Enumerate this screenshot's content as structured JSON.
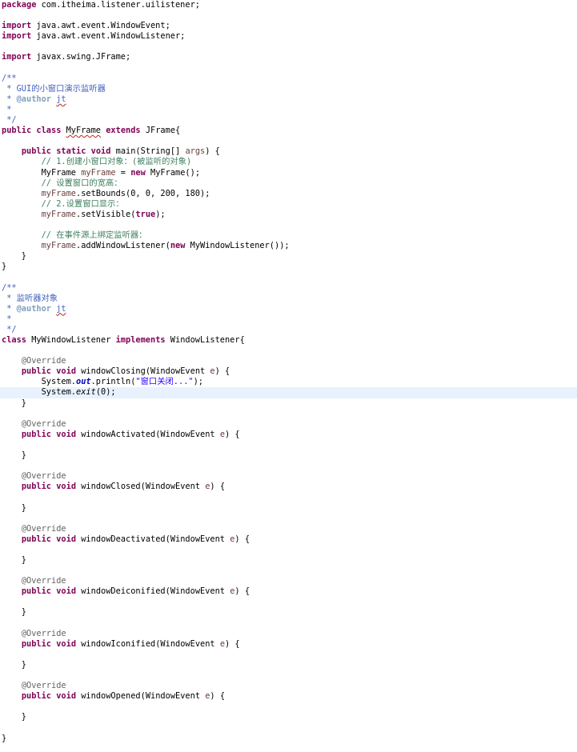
{
  "editor": {
    "lines": [
      [
        {
          "t": "package",
          "c": "kw"
        },
        {
          "t": " com.itheima.listener.uilistener;"
        }
      ],
      [],
      [
        {
          "t": "import",
          "c": "kw"
        },
        {
          "t": " java.awt.event.WindowEvent;"
        }
      ],
      [
        {
          "t": "import",
          "c": "kw"
        },
        {
          "t": " java.awt.event.WindowListener;"
        }
      ],
      [],
      [
        {
          "t": "import",
          "c": "kw"
        },
        {
          "t": " javax.swing.JFrame;"
        }
      ],
      [],
      [
        {
          "t": "/**",
          "c": "jd"
        }
      ],
      [
        {
          "t": " * GUI的小窗口演示监听器",
          "c": "jd"
        }
      ],
      [
        {
          "t": " * ",
          "c": "jd"
        },
        {
          "t": "@author",
          "c": "tag"
        },
        {
          "t": " ",
          "c": "jd"
        },
        {
          "t": "jt",
          "c": "jd sq"
        }
      ],
      [
        {
          "t": " *",
          "c": "jd"
        }
      ],
      [
        {
          "t": " */",
          "c": "jd"
        }
      ],
      [
        {
          "t": "public",
          "c": "kw"
        },
        {
          "t": " "
        },
        {
          "t": "class",
          "c": "kw"
        },
        {
          "t": " "
        },
        {
          "t": "MyFrame",
          "c": "sq"
        },
        {
          "t": " "
        },
        {
          "t": "extends",
          "c": "kw"
        },
        {
          "t": " JFrame{"
        }
      ],
      [],
      [
        {
          "t": "    "
        },
        {
          "t": "public",
          "c": "kw"
        },
        {
          "t": " "
        },
        {
          "t": "static",
          "c": "kw"
        },
        {
          "t": " "
        },
        {
          "t": "void",
          "c": "kw"
        },
        {
          "t": " main(String[] "
        },
        {
          "t": "args",
          "c": "vr"
        },
        {
          "t": ") {"
        }
      ],
      [
        {
          "t": "        "
        },
        {
          "t": "// 1.创建小窗口对象：(被监听的对象)",
          "c": "cm"
        }
      ],
      [
        {
          "t": "        MyFrame "
        },
        {
          "t": "myFrame",
          "c": "vr"
        },
        {
          "t": " = "
        },
        {
          "t": "new",
          "c": "kw"
        },
        {
          "t": " MyFrame();"
        }
      ],
      [
        {
          "t": "        "
        },
        {
          "t": "// 设置窗口的宽高：",
          "c": "cm"
        }
      ],
      [
        {
          "t": "        "
        },
        {
          "t": "myFrame",
          "c": "vr"
        },
        {
          "t": ".setBounds(0, 0, 200, 180);"
        }
      ],
      [
        {
          "t": "        "
        },
        {
          "t": "// 2.设置窗口显示：",
          "c": "cm"
        }
      ],
      [
        {
          "t": "        "
        },
        {
          "t": "myFrame",
          "c": "vr"
        },
        {
          "t": ".setVisible("
        },
        {
          "t": "true",
          "c": "kw"
        },
        {
          "t": ");"
        }
      ],
      [],
      [
        {
          "t": "        "
        },
        {
          "t": "// 在事件源上绑定监听器：",
          "c": "cm"
        }
      ],
      [
        {
          "t": "        "
        },
        {
          "t": "myFrame",
          "c": "vr"
        },
        {
          "t": ".addWindowListener("
        },
        {
          "t": "new",
          "c": "kw"
        },
        {
          "t": " MyWindowListener());"
        }
      ],
      [
        {
          "t": "    }"
        }
      ],
      [
        {
          "t": "}"
        }
      ],
      [],
      [
        {
          "t": "/**",
          "c": "jd"
        }
      ],
      [
        {
          "t": " * 监听器对象",
          "c": "jd"
        }
      ],
      [
        {
          "t": " * ",
          "c": "jd"
        },
        {
          "t": "@author",
          "c": "tag"
        },
        {
          "t": " ",
          "c": "jd"
        },
        {
          "t": "jt",
          "c": "jd sq"
        }
      ],
      [
        {
          "t": " *",
          "c": "jd"
        }
      ],
      [
        {
          "t": " */",
          "c": "jd"
        }
      ],
      [
        {
          "t": "class",
          "c": "kw"
        },
        {
          "t": " MyWindowListener "
        },
        {
          "t": "implements",
          "c": "kw"
        },
        {
          "t": " WindowListener{"
        }
      ],
      [],
      [
        {
          "t": "    "
        },
        {
          "t": "@Override",
          "c": "an"
        }
      ],
      [
        {
          "t": "    "
        },
        {
          "t": "public",
          "c": "kw"
        },
        {
          "t": " "
        },
        {
          "t": "void",
          "c": "kw"
        },
        {
          "t": " windowClosing(WindowEvent "
        },
        {
          "t": "e",
          "c": "vr"
        },
        {
          "t": ") {"
        }
      ],
      [
        {
          "t": "        System."
        },
        {
          "t": "out",
          "c": "fd"
        },
        {
          "t": ".println("
        },
        {
          "t": "\"窗口关闭...\"",
          "c": "st"
        },
        {
          "t": ");"
        }
      ],
      [
        {
          "t": "        System."
        },
        {
          "t": "exit",
          "c": "it"
        },
        {
          "t": "(0);"
        }
      ],
      [
        {
          "t": "    }"
        }
      ],
      [],
      [
        {
          "t": "    "
        },
        {
          "t": "@Override",
          "c": "an"
        }
      ],
      [
        {
          "t": "    "
        },
        {
          "t": "public",
          "c": "kw"
        },
        {
          "t": " "
        },
        {
          "t": "void",
          "c": "kw"
        },
        {
          "t": " windowActivated(WindowEvent "
        },
        {
          "t": "e",
          "c": "vr"
        },
        {
          "t": ") {"
        }
      ],
      [],
      [
        {
          "t": "    }"
        }
      ],
      [],
      [
        {
          "t": "    "
        },
        {
          "t": "@Override",
          "c": "an"
        }
      ],
      [
        {
          "t": "    "
        },
        {
          "t": "public",
          "c": "kw"
        },
        {
          "t": " "
        },
        {
          "t": "void",
          "c": "kw"
        },
        {
          "t": " windowClosed(WindowEvent "
        },
        {
          "t": "e",
          "c": "vr"
        },
        {
          "t": ") {"
        }
      ],
      [],
      [
        {
          "t": "    }"
        }
      ],
      [],
      [
        {
          "t": "    "
        },
        {
          "t": "@Override",
          "c": "an"
        }
      ],
      [
        {
          "t": "    "
        },
        {
          "t": "public",
          "c": "kw"
        },
        {
          "t": " "
        },
        {
          "t": "void",
          "c": "kw"
        },
        {
          "t": " windowDeactivated(WindowEvent "
        },
        {
          "t": "e",
          "c": "vr"
        },
        {
          "t": ") {"
        }
      ],
      [],
      [
        {
          "t": "    }"
        }
      ],
      [],
      [
        {
          "t": "    "
        },
        {
          "t": "@Override",
          "c": "an"
        }
      ],
      [
        {
          "t": "    "
        },
        {
          "t": "public",
          "c": "kw"
        },
        {
          "t": " "
        },
        {
          "t": "void",
          "c": "kw"
        },
        {
          "t": " windowDeiconified(WindowEvent "
        },
        {
          "t": "e",
          "c": "vr"
        },
        {
          "t": ") {"
        }
      ],
      [],
      [
        {
          "t": "    }"
        }
      ],
      [],
      [
        {
          "t": "    "
        },
        {
          "t": "@Override",
          "c": "an"
        }
      ],
      [
        {
          "t": "    "
        },
        {
          "t": "public",
          "c": "kw"
        },
        {
          "t": " "
        },
        {
          "t": "void",
          "c": "kw"
        },
        {
          "t": " windowIconified(WindowEvent "
        },
        {
          "t": "e",
          "c": "vr"
        },
        {
          "t": ") {"
        }
      ],
      [],
      [
        {
          "t": "    }"
        }
      ],
      [],
      [
        {
          "t": "    "
        },
        {
          "t": "@Override",
          "c": "an"
        }
      ],
      [
        {
          "t": "    "
        },
        {
          "t": "public",
          "c": "kw"
        },
        {
          "t": " "
        },
        {
          "t": "void",
          "c": "kw"
        },
        {
          "t": " windowOpened(WindowEvent "
        },
        {
          "t": "e",
          "c": "vr"
        },
        {
          "t": ") {"
        }
      ],
      [],
      [
        {
          "t": "    }"
        }
      ],
      [],
      [
        {
          "t": "}"
        }
      ]
    ],
    "highlighted_line": 37,
    "colors": {
      "keyword": "#7f0055",
      "comment": "#3f7f5f",
      "javadoc": "#3f5fbf",
      "annotation": "#646464",
      "string": "#2a00ff",
      "field": "#0000c0",
      "local_variable": "#6a3e3e",
      "current_line": "#e8f2fe"
    }
  }
}
